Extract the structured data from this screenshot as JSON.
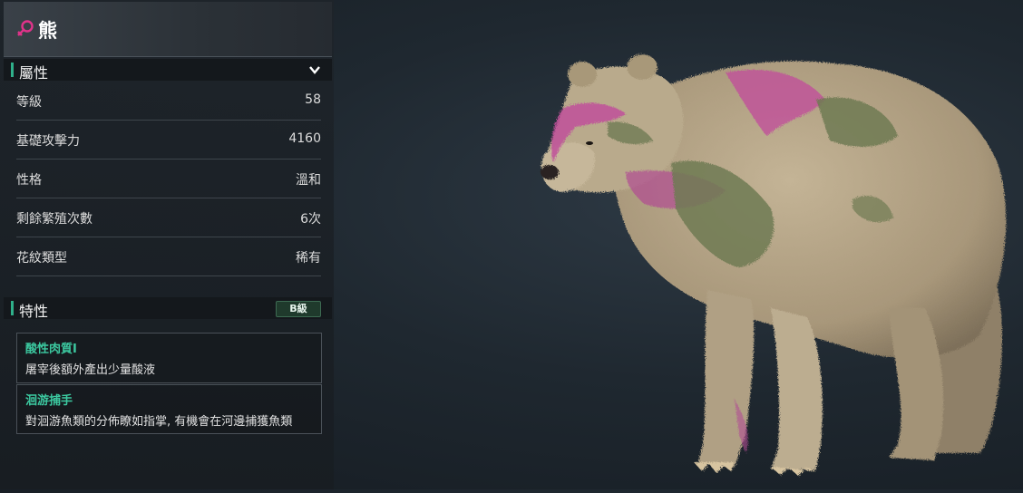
{
  "header": {
    "title": "熊",
    "gender_icon": "female-symbol-icon",
    "gender_color": "#e0338a"
  },
  "attributes": {
    "section_title": "屬性",
    "rows": [
      {
        "label": "等級",
        "value": "58"
      },
      {
        "label": "基礎攻擊力",
        "value": "4160"
      },
      {
        "label": "性格",
        "value": "溫和"
      },
      {
        "label": "剩餘繁殖次數",
        "value": "6次"
      },
      {
        "label": "花紋類型",
        "value": "稀有"
      }
    ]
  },
  "traits": {
    "section_title": "特性",
    "grade": "B級",
    "items": [
      {
        "name": "酸性肉質I",
        "desc": "屠宰後額外產出少量酸液"
      },
      {
        "name": "洄游捕手",
        "desc": "對洄游魚類的分佈瞭如指掌, 有機會在河邊捕獲魚類"
      }
    ]
  },
  "colors": {
    "accent": "#2fb08a",
    "trait_name": "#3cc9a0",
    "fur": "#b8a88a",
    "pattern_pink": "#c0509a",
    "pattern_green": "#6f7a52"
  }
}
